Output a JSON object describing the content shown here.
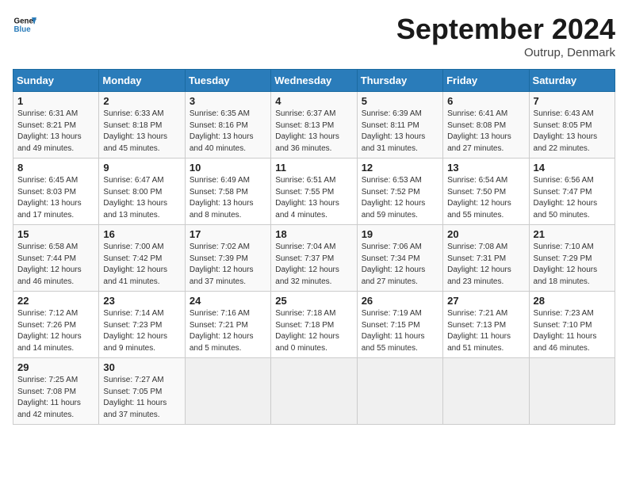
{
  "logo": {
    "line1": "General",
    "line2": "Blue"
  },
  "title": "September 2024",
  "subtitle": "Outrup, Denmark",
  "days_header": [
    "Sunday",
    "Monday",
    "Tuesday",
    "Wednesday",
    "Thursday",
    "Friday",
    "Saturday"
  ],
  "weeks": [
    [
      {
        "day": "1",
        "detail": "Sunrise: 6:31 AM\nSunset: 8:21 PM\nDaylight: 13 hours\nand 49 minutes."
      },
      {
        "day": "2",
        "detail": "Sunrise: 6:33 AM\nSunset: 8:18 PM\nDaylight: 13 hours\nand 45 minutes."
      },
      {
        "day": "3",
        "detail": "Sunrise: 6:35 AM\nSunset: 8:16 PM\nDaylight: 13 hours\nand 40 minutes."
      },
      {
        "day": "4",
        "detail": "Sunrise: 6:37 AM\nSunset: 8:13 PM\nDaylight: 13 hours\nand 36 minutes."
      },
      {
        "day": "5",
        "detail": "Sunrise: 6:39 AM\nSunset: 8:11 PM\nDaylight: 13 hours\nand 31 minutes."
      },
      {
        "day": "6",
        "detail": "Sunrise: 6:41 AM\nSunset: 8:08 PM\nDaylight: 13 hours\nand 27 minutes."
      },
      {
        "day": "7",
        "detail": "Sunrise: 6:43 AM\nSunset: 8:05 PM\nDaylight: 13 hours\nand 22 minutes."
      }
    ],
    [
      {
        "day": "8",
        "detail": "Sunrise: 6:45 AM\nSunset: 8:03 PM\nDaylight: 13 hours\nand 17 minutes."
      },
      {
        "day": "9",
        "detail": "Sunrise: 6:47 AM\nSunset: 8:00 PM\nDaylight: 13 hours\nand 13 minutes."
      },
      {
        "day": "10",
        "detail": "Sunrise: 6:49 AM\nSunset: 7:58 PM\nDaylight: 13 hours\nand 8 minutes."
      },
      {
        "day": "11",
        "detail": "Sunrise: 6:51 AM\nSunset: 7:55 PM\nDaylight: 13 hours\nand 4 minutes."
      },
      {
        "day": "12",
        "detail": "Sunrise: 6:53 AM\nSunset: 7:52 PM\nDaylight: 12 hours\nand 59 minutes."
      },
      {
        "day": "13",
        "detail": "Sunrise: 6:54 AM\nSunset: 7:50 PM\nDaylight: 12 hours\nand 55 minutes."
      },
      {
        "day": "14",
        "detail": "Sunrise: 6:56 AM\nSunset: 7:47 PM\nDaylight: 12 hours\nand 50 minutes."
      }
    ],
    [
      {
        "day": "15",
        "detail": "Sunrise: 6:58 AM\nSunset: 7:44 PM\nDaylight: 12 hours\nand 46 minutes."
      },
      {
        "day": "16",
        "detail": "Sunrise: 7:00 AM\nSunset: 7:42 PM\nDaylight: 12 hours\nand 41 minutes."
      },
      {
        "day": "17",
        "detail": "Sunrise: 7:02 AM\nSunset: 7:39 PM\nDaylight: 12 hours\nand 37 minutes."
      },
      {
        "day": "18",
        "detail": "Sunrise: 7:04 AM\nSunset: 7:37 PM\nDaylight: 12 hours\nand 32 minutes."
      },
      {
        "day": "19",
        "detail": "Sunrise: 7:06 AM\nSunset: 7:34 PM\nDaylight: 12 hours\nand 27 minutes."
      },
      {
        "day": "20",
        "detail": "Sunrise: 7:08 AM\nSunset: 7:31 PM\nDaylight: 12 hours\nand 23 minutes."
      },
      {
        "day": "21",
        "detail": "Sunrise: 7:10 AM\nSunset: 7:29 PM\nDaylight: 12 hours\nand 18 minutes."
      }
    ],
    [
      {
        "day": "22",
        "detail": "Sunrise: 7:12 AM\nSunset: 7:26 PM\nDaylight: 12 hours\nand 14 minutes."
      },
      {
        "day": "23",
        "detail": "Sunrise: 7:14 AM\nSunset: 7:23 PM\nDaylight: 12 hours\nand 9 minutes."
      },
      {
        "day": "24",
        "detail": "Sunrise: 7:16 AM\nSunset: 7:21 PM\nDaylight: 12 hours\nand 5 minutes."
      },
      {
        "day": "25",
        "detail": "Sunrise: 7:18 AM\nSunset: 7:18 PM\nDaylight: 12 hours\nand 0 minutes."
      },
      {
        "day": "26",
        "detail": "Sunrise: 7:19 AM\nSunset: 7:15 PM\nDaylight: 11 hours\nand 55 minutes."
      },
      {
        "day": "27",
        "detail": "Sunrise: 7:21 AM\nSunset: 7:13 PM\nDaylight: 11 hours\nand 51 minutes."
      },
      {
        "day": "28",
        "detail": "Sunrise: 7:23 AM\nSunset: 7:10 PM\nDaylight: 11 hours\nand 46 minutes."
      }
    ],
    [
      {
        "day": "29",
        "detail": "Sunrise: 7:25 AM\nSunset: 7:08 PM\nDaylight: 11 hours\nand 42 minutes."
      },
      {
        "day": "30",
        "detail": "Sunrise: 7:27 AM\nSunset: 7:05 PM\nDaylight: 11 hours\nand 37 minutes."
      },
      {
        "day": "",
        "detail": ""
      },
      {
        "day": "",
        "detail": ""
      },
      {
        "day": "",
        "detail": ""
      },
      {
        "day": "",
        "detail": ""
      },
      {
        "day": "",
        "detail": ""
      }
    ]
  ]
}
